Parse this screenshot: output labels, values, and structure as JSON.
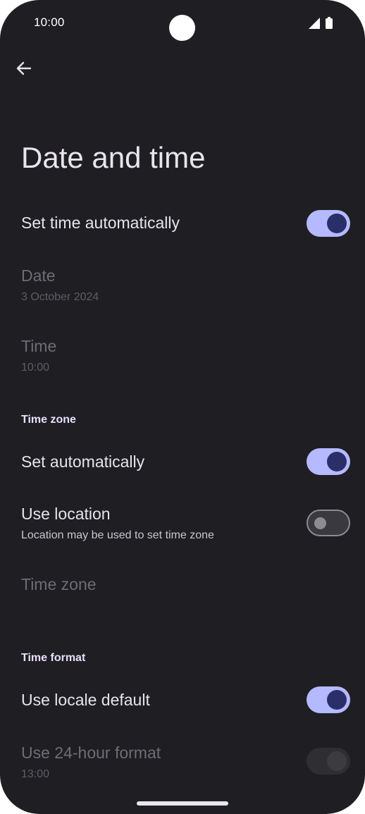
{
  "status_bar": {
    "time": "10:00"
  },
  "page": {
    "title": "Date and time"
  },
  "items": {
    "set_time_auto": {
      "title": "Set time automatically",
      "enabled": true
    },
    "date": {
      "title": "Date",
      "value": "3 October 2024"
    },
    "time": {
      "title": "Time",
      "value": "10:00"
    },
    "time_zone_header": "Time zone",
    "tz_auto": {
      "title": "Set automatically",
      "enabled": true
    },
    "use_location": {
      "title": "Use location",
      "subtitle": "Location may be used to set time zone",
      "enabled": false
    },
    "time_zone": {
      "title": "Time zone"
    },
    "time_format_header": "Time format",
    "locale_default": {
      "title": "Use locale default",
      "enabled": true
    },
    "hour24": {
      "title": "Use 24-hour format",
      "value": "13:00",
      "enabled": false
    }
  },
  "icons": {
    "back": "arrow-back-icon",
    "signal": "signal-icon",
    "battery": "battery-icon"
  },
  "colors": {
    "background": "#1f1e23",
    "toggle_on": "#b5b9ff",
    "thumb_on": "#2a2f6a"
  }
}
